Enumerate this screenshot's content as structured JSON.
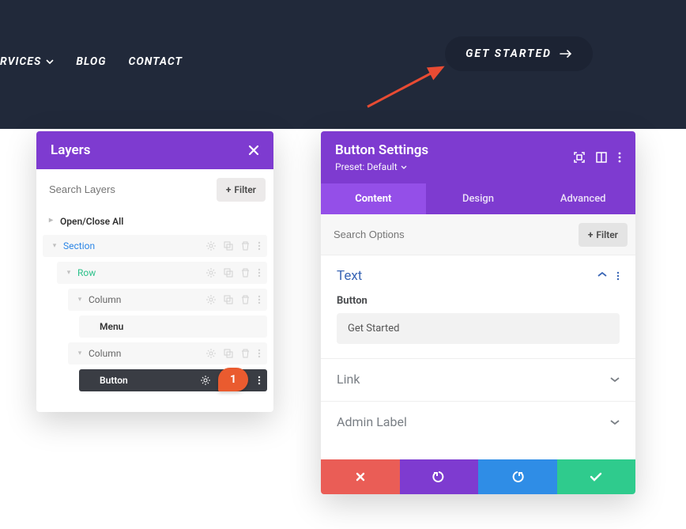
{
  "nav": {
    "services": "RVICES",
    "blog": "BLOG",
    "contact": "CONTACT"
  },
  "cta": {
    "label": "GET STARTED"
  },
  "layers": {
    "title": "Layers",
    "search_placeholder": "Search Layers",
    "filter": "Filter",
    "open_close": "Open/Close All",
    "items": {
      "section": "Section",
      "row": "Row",
      "column1": "Column",
      "menu": "Menu",
      "column2": "Column",
      "button": "Button"
    },
    "callout": "1"
  },
  "settings": {
    "title": "Button Settings",
    "preset": "Preset: Default",
    "tabs": {
      "content": "Content",
      "design": "Design",
      "advanced": "Advanced"
    },
    "search_placeholder": "Search Options",
    "filter": "Filter",
    "sections": {
      "text": {
        "title": "Text",
        "field_label": "Button",
        "field_value": "Get Started"
      },
      "link": {
        "title": "Link"
      },
      "admin": {
        "title": "Admin Label"
      }
    }
  }
}
